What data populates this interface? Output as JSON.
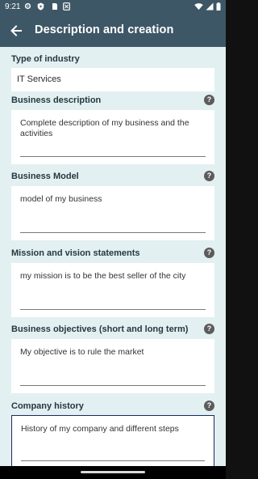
{
  "status_bar": {
    "time": "9:21",
    "left_icons": [
      "gear-icon",
      "play-protect-icon",
      "notification-icon",
      "screenshot-icon"
    ],
    "right_icons": [
      "wifi-icon",
      "signal-icon",
      "battery-icon"
    ]
  },
  "app_bar": {
    "title": "Description and creation",
    "back_icon": "arrow-left-icon"
  },
  "form": {
    "type_of_industry": {
      "label": "Type of industry",
      "value": "IT Services"
    },
    "business_description": {
      "label": "Business description",
      "value": "Complete description of my business and the activities"
    },
    "business_model": {
      "label": "Business Model",
      "value": "model of my business"
    },
    "mission_vision": {
      "label": "Mission and vision statements",
      "value": "my mission is to be the best seller of the city"
    },
    "business_objectives": {
      "label": "Business objectives (short and long term)",
      "value": "My objective is to rule the market"
    },
    "company_history": {
      "label": "Company history",
      "value": "History of my company and different steps"
    },
    "help_glyph": "?"
  },
  "colors": {
    "app_bar": "#3e5766",
    "background": "#e2f0f2",
    "label": "#27373f",
    "help_icon": "#5c5c5c",
    "focus_border": "#1b2a5a"
  }
}
